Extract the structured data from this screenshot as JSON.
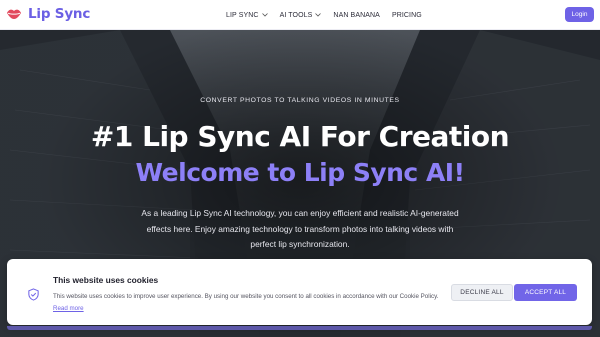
{
  "brand": {
    "name": "Lip Sync",
    "accent": "#6e62e6"
  },
  "nav": {
    "items": [
      {
        "label": "LIP SYNC",
        "has_dropdown": true
      },
      {
        "label": "AI TOOLS",
        "has_dropdown": true
      },
      {
        "label": "NAN BANANA",
        "has_dropdown": false
      },
      {
        "label": "PRICING",
        "has_dropdown": false
      }
    ],
    "login_label": "Login"
  },
  "hero": {
    "eyebrow": "CONVERT PHOTOS TO TALKING VIDEOS IN MINUTES",
    "title": "#1 Lip Sync AI For Creation",
    "subtitle": "Welcome to Lip Sync AI!",
    "subtitle_color": "#8d80f7",
    "description": "As a leading Lip Sync AI technology, you can enjoy efficient and realistic AI-generated effects here. Enjoy amazing technology to transform photos into talking videos with perfect lip synchronization."
  },
  "cookie": {
    "icon": "shield-check-icon",
    "title": "This website uses cookies",
    "text": "This website uses cookies to improve user experience. By using our website you consent to all cookies in accordance with our Cookie Policy.",
    "link_label": "Read more",
    "decline_label": "DECLINE ALL",
    "accept_label": "ACCEPT ALL"
  }
}
